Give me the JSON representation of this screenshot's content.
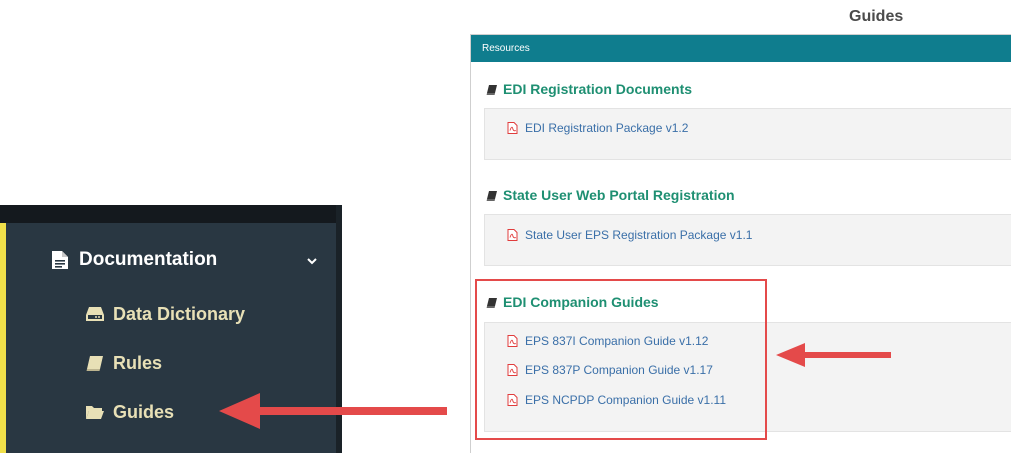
{
  "sidebar": {
    "documentation_label": "Documentation",
    "items": [
      {
        "label": "Data Dictionary",
        "icon": "hdd-icon"
      },
      {
        "label": "Rules",
        "icon": "book-icon"
      },
      {
        "label": "Guides",
        "icon": "folder-open-icon"
      }
    ],
    "accent_color": "#f0e04a",
    "background_color": "#293742"
  },
  "page_heading": "Guides",
  "panel": {
    "header": "Resources",
    "header_color": "#0f7d8e",
    "sections": [
      {
        "title": "EDI Registration Documents",
        "links": [
          "EDI Registration Package v1.2"
        ]
      },
      {
        "title": "State User Web Portal Registration",
        "links": [
          "State User EPS Registration Package v1.1"
        ]
      },
      {
        "title": "EDI Companion Guides",
        "links": [
          "EPS 837I Companion Guide v1.12",
          "EPS 837P Companion Guide v1.17",
          "EPS NCPDP Companion Guide v1.11"
        ]
      }
    ]
  },
  "annotation": {
    "color": "#e44a4a",
    "highlighted_section": "EDI Companion Guides",
    "arrow_points_to": [
      "Guides",
      "EDI Companion Guides"
    ]
  }
}
